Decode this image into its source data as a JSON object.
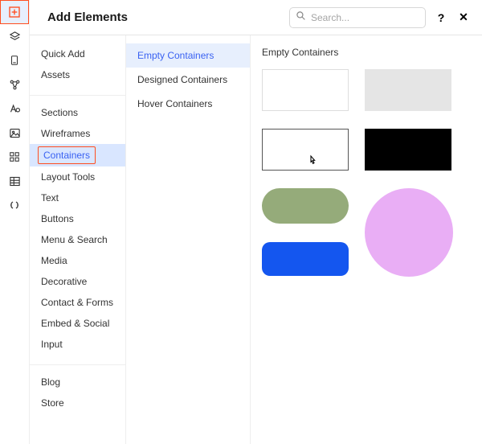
{
  "header": {
    "title": "Add Elements",
    "search_placeholder": "Search...",
    "help": "?",
    "close": "✕"
  },
  "rail": {
    "items": [
      {
        "name": "add-element-icon",
        "active": true
      },
      {
        "name": "layers-icon"
      },
      {
        "name": "page-icon"
      },
      {
        "name": "share-icon"
      },
      {
        "name": "text-style-icon"
      },
      {
        "name": "image-icon"
      },
      {
        "name": "apps-icon"
      },
      {
        "name": "table-icon"
      },
      {
        "name": "code-icon"
      }
    ]
  },
  "categories": [
    {
      "group": [
        {
          "label": "Quick Add"
        },
        {
          "label": "Assets"
        }
      ]
    },
    {
      "group": [
        {
          "label": "Sections"
        },
        {
          "label": "Wireframes"
        },
        {
          "label": "Containers",
          "selected": true,
          "highlighted": true
        },
        {
          "label": "Layout Tools"
        },
        {
          "label": "Text"
        },
        {
          "label": "Buttons"
        },
        {
          "label": "Menu & Search"
        },
        {
          "label": "Media"
        },
        {
          "label": "Decorative"
        },
        {
          "label": "Contact & Forms"
        },
        {
          "label": "Embed & Social"
        },
        {
          "label": "Input"
        }
      ]
    },
    {
      "group": [
        {
          "label": "Blog"
        },
        {
          "label": "Store"
        }
      ]
    }
  ],
  "subcategories": [
    {
      "label": "Empty Containers",
      "active": true
    },
    {
      "label": "Designed Containers"
    },
    {
      "label": "Hover Containers"
    }
  ],
  "preview": {
    "heading": "Empty Containers",
    "items": [
      {
        "name": "container-white",
        "cls": "plain-white"
      },
      {
        "name": "container-grey",
        "cls": "plain-grey"
      },
      {
        "name": "container-outline",
        "cls": "outline-white",
        "cursor": true
      },
      {
        "name": "container-black",
        "cls": "black"
      },
      {
        "name": "container-pill-green",
        "cls": "pill-green"
      },
      {
        "name": "container-circle-pink",
        "cls": "circle"
      },
      {
        "name": "container-pill-blue",
        "cls": "pill-blue"
      }
    ]
  }
}
